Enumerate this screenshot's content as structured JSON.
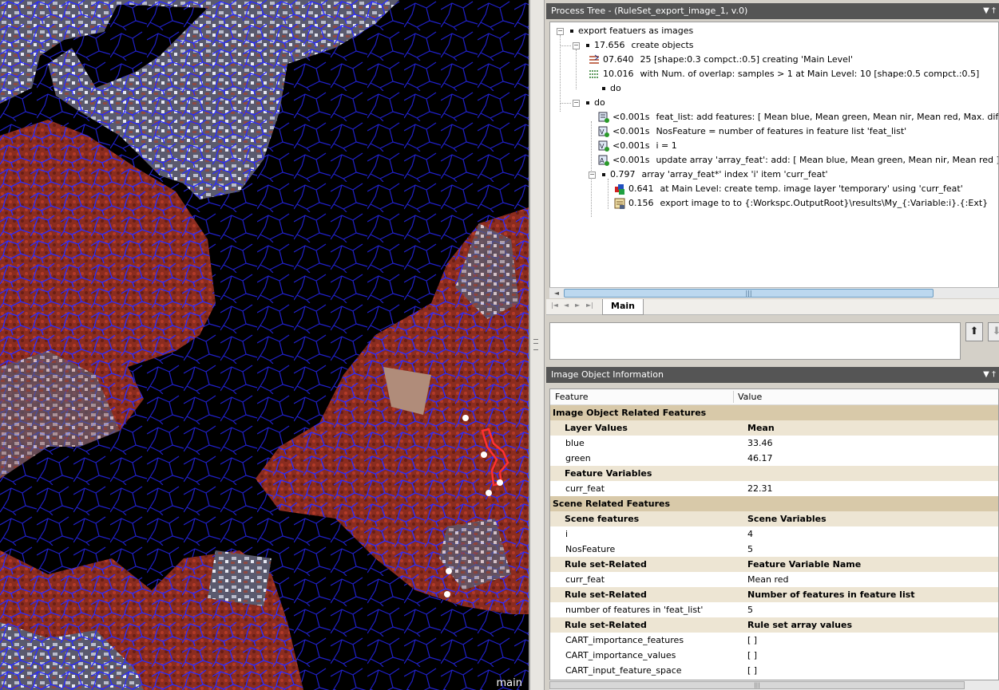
{
  "viewer": {
    "label": "main"
  },
  "process_tree": {
    "title": "Process Tree - (RuleSet_export_image_1, v.0)",
    "pin": "▼ †",
    "rows": [
      {
        "time": "",
        "text": "export featuers as images"
      },
      {
        "time": "17.656",
        "text": "create objects"
      },
      {
        "time": "07.640",
        "text": "25 [shape:0.3 compct.:0.5] creating 'Main Level'"
      },
      {
        "time": "10.016",
        "text": "with Num. of overlap: samples > 1  at  Main Level: 10 [shape:0.5 compct.:0.5]"
      },
      {
        "time": "",
        "text": "do"
      },
      {
        "time": "",
        "text": "do"
      },
      {
        "time": "<0.001s",
        "text": "feat_list: add features: [ Mean blue, Mean green, Mean nir, Mean red, Max. diff. ]"
      },
      {
        "time": "<0.001s",
        "text": "NosFeature = number of features in feature list 'feat_list'"
      },
      {
        "time": "<0.001s",
        "text": "i = 1"
      },
      {
        "time": "<0.001s",
        "text": "update array 'array_feat': add: [ Mean blue, Mean green, Mean nir, Mean red ]"
      },
      {
        "time": "0.797",
        "text": "array 'array_feat*' index 'i' item 'curr_feat'"
      },
      {
        "time": "0.641",
        "text": "at  Main Level: create temp. image layer 'temporary' using 'curr_feat'"
      },
      {
        "time": "0.156",
        "text": "export image to to {:Workspc.OutputRoot}\\results\\My_{:Variable:i}.{:Ext}"
      }
    ],
    "tab": "Main"
  },
  "image_object_info": {
    "title": "Image Object Information",
    "pin": "▼ †",
    "col_feature": "Feature",
    "col_value": "Value",
    "rows": [
      {
        "kind": "group",
        "feature": "Image Object Related Features",
        "value": ""
      },
      {
        "kind": "sub",
        "feature": "Layer Values",
        "value": "Mean"
      },
      {
        "kind": "item",
        "feature": "blue",
        "value": "33.46"
      },
      {
        "kind": "item",
        "feature": "green",
        "value": "46.17"
      },
      {
        "kind": "sub",
        "feature": "Feature Variables",
        "value": ""
      },
      {
        "kind": "item",
        "feature": "curr_feat",
        "value": "22.31"
      },
      {
        "kind": "group",
        "feature": "Scene Related Features",
        "value": ""
      },
      {
        "kind": "sub",
        "feature": "Scene features",
        "value": "Scene Variables"
      },
      {
        "kind": "item",
        "feature": "i",
        "value": "4"
      },
      {
        "kind": "item",
        "feature": "NosFeature",
        "value": "5"
      },
      {
        "kind": "sub",
        "feature": "Rule set-Related",
        "value": "Feature Variable Name"
      },
      {
        "kind": "item",
        "feature": "curr_feat",
        "value": "Mean red"
      },
      {
        "kind": "sub",
        "feature": "Rule set-Related",
        "value": "Number of features in feature list"
      },
      {
        "kind": "item",
        "feature": "number of features in 'feat_list'",
        "value": "5"
      },
      {
        "kind": "sub",
        "feature": "Rule set-Related",
        "value": "Rule set array values"
      },
      {
        "kind": "item",
        "feature": "CART_importance_features",
        "value": "[ ]"
      },
      {
        "kind": "item",
        "feature": "CART_importance_values",
        "value": "[ ]"
      },
      {
        "kind": "item",
        "feature": "CART_input_feature_space",
        "value": "[ ]"
      }
    ]
  },
  "colors": {
    "segment_outline": "#2020ff",
    "vegetation": "#8a2a1c",
    "selected_object": "#ff3030",
    "title_bar": "#555555",
    "group_row": "#d8c9a9"
  }
}
